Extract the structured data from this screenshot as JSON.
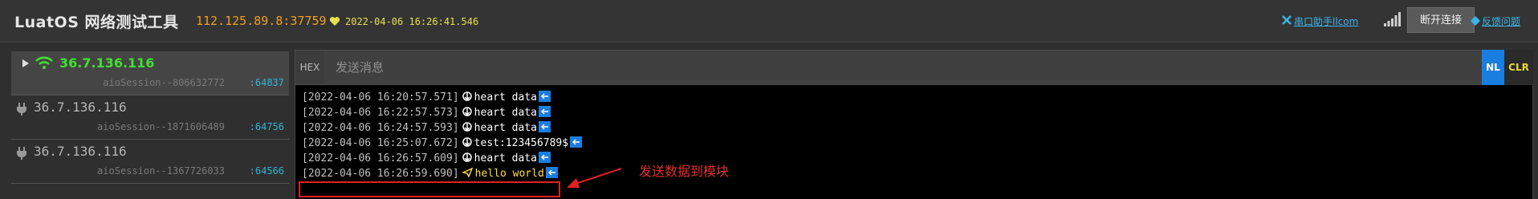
{
  "header": {
    "app_title": "LuatOS 网络测试工具",
    "server_address": "112.125.89.8:37759",
    "time": "2022-04-06 16:26:41.546",
    "serial_link": "串口助手llcom",
    "disconnect_label": "断开连接",
    "feedback_link": "反馈问题"
  },
  "sessions": [
    {
      "ip": "36.7.136.116",
      "session_id": "aioSession--806632772",
      "port": ":64837",
      "active": true
    },
    {
      "ip": "36.7.136.116",
      "session_id": "aioSession--1871606489",
      "port": ":64756",
      "active": false
    },
    {
      "ip": "36.7.136.116",
      "session_id": "aioSession--1367726033",
      "port": ":64566",
      "active": false
    }
  ],
  "send_bar": {
    "hex_label": "HEX",
    "placeholder": "发送消息",
    "nl_label": "NL",
    "clr_label": "CLR"
  },
  "log": [
    {
      "ts": "[2022-04-06 16:20:57.571]",
      "dir": "recv",
      "msg": "heart data"
    },
    {
      "ts": "[2022-04-06 16:22:57.573]",
      "dir": "recv",
      "msg": "heart data"
    },
    {
      "ts": "[2022-04-06 16:24:57.593]",
      "dir": "recv",
      "msg": "heart data"
    },
    {
      "ts": "[2022-04-06 16:25:07.672]",
      "dir": "recv",
      "msg": "test:123456789$"
    },
    {
      "ts": "[2022-04-06 16:26:57.609]",
      "dir": "recv",
      "msg": "heart data"
    },
    {
      "ts": "[2022-04-06 16:26:59.690]",
      "dir": "send",
      "msg": "hello world"
    }
  ],
  "annotation": "发送数据到模块",
  "colors": {
    "accent": "#1a7ee0",
    "active_ip": "#40e030",
    "port": "#2fb6d6",
    "address": "#f0a020",
    "annotation": "#e03030",
    "send_message": "#ffe040"
  },
  "icons": {
    "heart": "heart-icon",
    "wifi": "wifi-icon",
    "plug": "plug-icon",
    "recv": "receive-icon",
    "send": "send-icon",
    "newline": "newline-icon"
  }
}
